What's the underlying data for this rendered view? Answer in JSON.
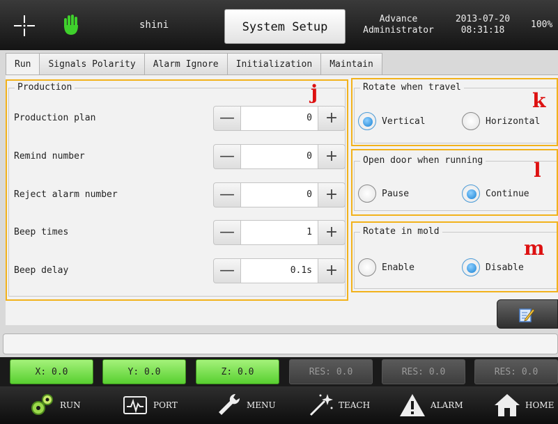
{
  "header": {
    "user": "shini",
    "title": "System Setup",
    "user_level_line1": "Advance",
    "user_level_line2": "Administrator",
    "date": "2013-07-20",
    "time": "08:31:18",
    "percent": "100%"
  },
  "tabs": [
    {
      "label": "Run",
      "active": true
    },
    {
      "label": "Signals Polarity",
      "active": false
    },
    {
      "label": "Alarm Ignore",
      "active": false
    },
    {
      "label": "Initialization",
      "active": false
    },
    {
      "label": "Maintain",
      "active": false
    }
  ],
  "production": {
    "title": "Production",
    "annotation": "j",
    "rows": [
      {
        "label": "Production plan",
        "value": "0"
      },
      {
        "label": "Remind number",
        "value": "0"
      },
      {
        "label": "Reject alarm number",
        "value": "0"
      },
      {
        "label": "Beep times",
        "value": "1"
      },
      {
        "label": "Beep delay",
        "value": "0.1s"
      }
    ],
    "minus_symbol": "—",
    "plus_symbol": "+"
  },
  "rotate_travel": {
    "title": "Rotate when travel",
    "annotation": "k",
    "options": [
      {
        "label": "Vertical",
        "selected": true
      },
      {
        "label": "Horizontal",
        "selected": false
      }
    ]
  },
  "open_door": {
    "title": "Open door when running",
    "annotation": "l",
    "options": [
      {
        "label": "Pause",
        "selected": false
      },
      {
        "label": "Continue",
        "selected": true
      }
    ]
  },
  "rotate_mold": {
    "title": "Rotate in mold",
    "annotation": "m",
    "options": [
      {
        "label": "Enable",
        "selected": false
      },
      {
        "label": "Disable",
        "selected": true
      }
    ]
  },
  "axes": [
    {
      "label": "X: 0.0",
      "active": true
    },
    {
      "label": "Y: 0.0",
      "active": true
    },
    {
      "label": "Z: 0.0",
      "active": true
    },
    {
      "label": "RES: 0.0",
      "active": false
    },
    {
      "label": "RES: 0.0",
      "active": false
    },
    {
      "label": "RES: 0.0",
      "active": false
    }
  ],
  "nav": [
    {
      "label": "RUN",
      "icon": "gears-icon"
    },
    {
      "label": "PORT",
      "icon": "port-icon"
    },
    {
      "label": "MENU",
      "icon": "wrench-icon"
    },
    {
      "label": "TEACH",
      "icon": "magic-wand-icon"
    },
    {
      "label": "ALARM",
      "icon": "warning-icon"
    },
    {
      "label": "HOME",
      "icon": "home-icon"
    }
  ],
  "colors": {
    "annotation": "#dd1111",
    "highlight": "#f2b21b",
    "axis_active": "#58cf30",
    "radio_selected": "#1a82d4"
  }
}
